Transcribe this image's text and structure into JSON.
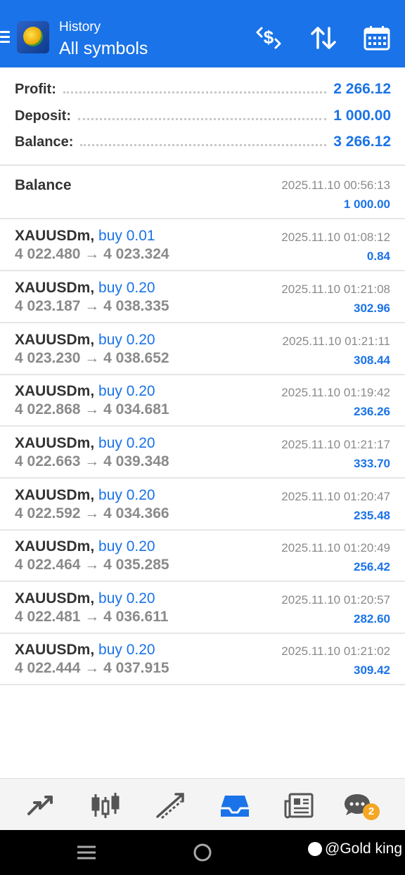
{
  "header": {
    "subtitle": "History",
    "title": "All symbols",
    "icons": [
      "menu-icon",
      "currency-filter-icon",
      "sort-icon",
      "calendar-icon"
    ],
    "color": "#1a73e8"
  },
  "summary": {
    "profit_label": "Profit:",
    "profit_value": "2 266.12",
    "deposit_label": "Deposit:",
    "deposit_value": "1 000.00",
    "balance_label": "Balance:",
    "balance_value": "3 266.12"
  },
  "balance_entry": {
    "label": "Balance",
    "time": "2025.11.10 00:56:13",
    "amount": "1 000.00"
  },
  "deals": [
    {
      "symbol": "XAUUSDm,",
      "type": "buy 0.01",
      "open": "4 022.480",
      "close": "4 023.324",
      "time": "2025.11.10 01:08:12",
      "profit": "0.84"
    },
    {
      "symbol": "XAUUSDm,",
      "type": "buy 0.20",
      "open": "4 023.187",
      "close": "4 038.335",
      "time": "2025.11.10 01:21:08",
      "profit": "302.96"
    },
    {
      "symbol": "XAUUSDm,",
      "type": "buy 0.20",
      "open": "4 023.230",
      "close": "4 038.652",
      "time": "2025.11.10 01:21:11",
      "profit": "308.44"
    },
    {
      "symbol": "XAUUSDm,",
      "type": "buy 0.20",
      "open": "4 022.868",
      "close": "4 034.681",
      "time": "2025.11.10 01:19:42",
      "profit": "236.26"
    },
    {
      "symbol": "XAUUSDm,",
      "type": "buy 0.20",
      "open": "4 022.663",
      "close": "4 039.348",
      "time": "2025.11.10 01:21:17",
      "profit": "333.70"
    },
    {
      "symbol": "XAUUSDm,",
      "type": "buy 0.20",
      "open": "4 022.592",
      "close": "4 034.366",
      "time": "2025.11.10 01:20:47",
      "profit": "235.48"
    },
    {
      "symbol": "XAUUSDm,",
      "type": "buy 0.20",
      "open": "4 022.464",
      "close": "4 035.285",
      "time": "2025.11.10 01:20:49",
      "profit": "256.42"
    },
    {
      "symbol": "XAUUSDm,",
      "type": "buy 0.20",
      "open": "4 022.481",
      "close": "4 036.611",
      "time": "2025.11.10 01:20:57",
      "profit": "282.60"
    },
    {
      "symbol": "XAUUSDm,",
      "type": "buy 0.20",
      "open": "4 022.444",
      "close": "4 037.915",
      "time": "2025.11.10 01:21:02",
      "profit": "309.42"
    }
  ],
  "arrow": "→",
  "tabbar": {
    "tabs": [
      "quotes-icon",
      "chart-icon",
      "trade-icon",
      "history-icon",
      "news-icon",
      "chat-icon"
    ],
    "active": "history-icon",
    "chat_badge": "2"
  },
  "watermark": "@Gold king"
}
